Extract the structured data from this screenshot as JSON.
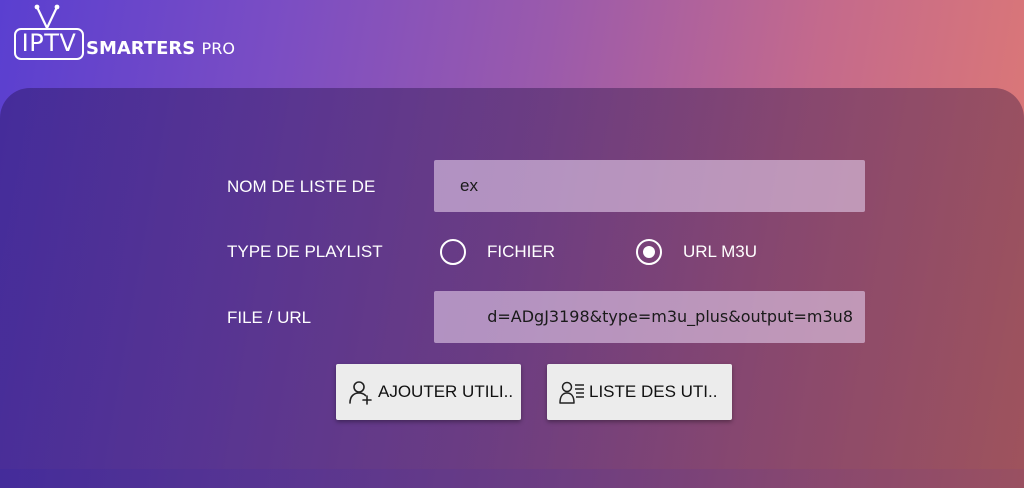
{
  "app": {
    "logo_text": "IPTV",
    "logo_brand": "SMARTERS",
    "logo_suffix": "PRO"
  },
  "form": {
    "playlist_name": {
      "label": "NOM DE LISTE DE",
      "value": "ex"
    },
    "playlist_type": {
      "label": "TYPE DE PLAYLIST",
      "options": [
        {
          "label": "FICHIER",
          "selected": false
        },
        {
          "label": "URL M3U",
          "selected": true
        }
      ]
    },
    "file_url": {
      "label": "FILE / URL",
      "value": "d=ADgJ3198&type=m3u_plus&output=m3u8"
    }
  },
  "actions": {
    "add_user_label": "AJOUTER UTILI..",
    "list_users_label": "LISTE DES UTI.."
  },
  "icons": {
    "add_user": "add-user-icon",
    "list_users": "user-list-icon",
    "logo_antenna": "tv-antenna-icon"
  },
  "colors": {
    "bg_left": "#5a3fd0",
    "bg_right": "#e07a72",
    "input_bg": "#d9c4df",
    "button_bg": "#ececec"
  }
}
